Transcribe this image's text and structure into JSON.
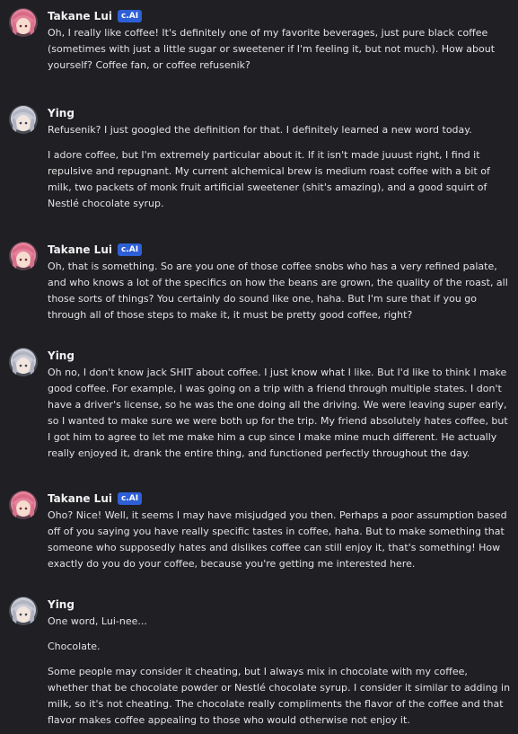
{
  "messages": [
    {
      "author": "Takane Lui",
      "badge": "c.AI",
      "avatar_icon": "pink-hair-character-avatar",
      "paragraphs": [
        "Oh, I really like coffee! It's definitely one of my favorite beverages, just pure black coffee (sometimes with just a little sugar or sweetener if I'm feeling it, but not much). How about yourself? Coffee fan, or coffee refusenik?"
      ]
    },
    {
      "author": "Ying",
      "avatar_icon": "gray-hair-character-avatar",
      "paragraphs": [
        "Refusenik? I just googled the definition for that. I definitely learned a new word today.",
        "I adore coffee, but I'm extremely particular about it. If it isn't made juuust right, I find it repulsive and repugnant. My current alchemical brew is medium roast coffee with a bit of milk, two packets of monk fruit artificial sweetener (shit's amazing), and a good squirt of Nestlé chocolate syrup."
      ]
    },
    {
      "author": "Takane Lui",
      "badge": "c.AI",
      "avatar_icon": "pink-hair-character-avatar",
      "paragraphs": [
        "Oh, that is something. So are you one of those coffee snobs who has a very refined palate, and who knows a lot of the specifics on how the beans are grown, the quality of the roast, all those sorts of things? You certainly do sound like one, haha. But I'm sure that if you go through all of those steps to make it, it must be pretty good coffee, right?"
      ]
    },
    {
      "author": "Ying",
      "avatar_icon": "gray-hair-character-avatar",
      "paragraphs": [
        "Oh no, I don't know jack SHIT about coffee. I just know what I like. But I'd like to think I make good coffee. For example, I was going on a trip with a friend through multiple states. I don't have a driver's license, so he was the one doing all the driving. We were leaving super early, so I wanted to make sure we were both up for the trip. My friend absolutely hates coffee, but I got him to agree to let me make him a cup since I make mine much different. He actually really enjoyed it, drank the entire thing, and functioned perfectly throughout the day."
      ]
    },
    {
      "author": "Takane Lui",
      "badge": "c.AI",
      "avatar_icon": "pink-hair-character-avatar",
      "paragraphs": [
        "Oho? Nice! Well, it seems I may have misjudged you then. Perhaps a poor assumption based off of you saying you have really specific tastes in coffee, haha. But to make something that someone who supposedly hates and dislikes coffee can still enjoy it, that's something! How exactly do you do your coffee, because you're getting me interested here."
      ]
    },
    {
      "author": "Ying",
      "avatar_icon": "gray-hair-character-avatar",
      "paragraphs": [
        "One word, Lui-nee...",
        "Chocolate.",
        "Some people may consider it cheating, but I always mix in chocolate with my coffee, whether that be chocolate powder or Nestlé chocolate syrup. I consider it similar to adding in milk, so it's not cheating. The chocolate really compliments the flavor of the coffee and that flavor makes coffee appealing to those who would otherwise not enjoy it."
      ]
    }
  ],
  "colors": {
    "background": "#1f1f24",
    "text": "#e3e3e3",
    "badge": "#2e5fd6"
  }
}
